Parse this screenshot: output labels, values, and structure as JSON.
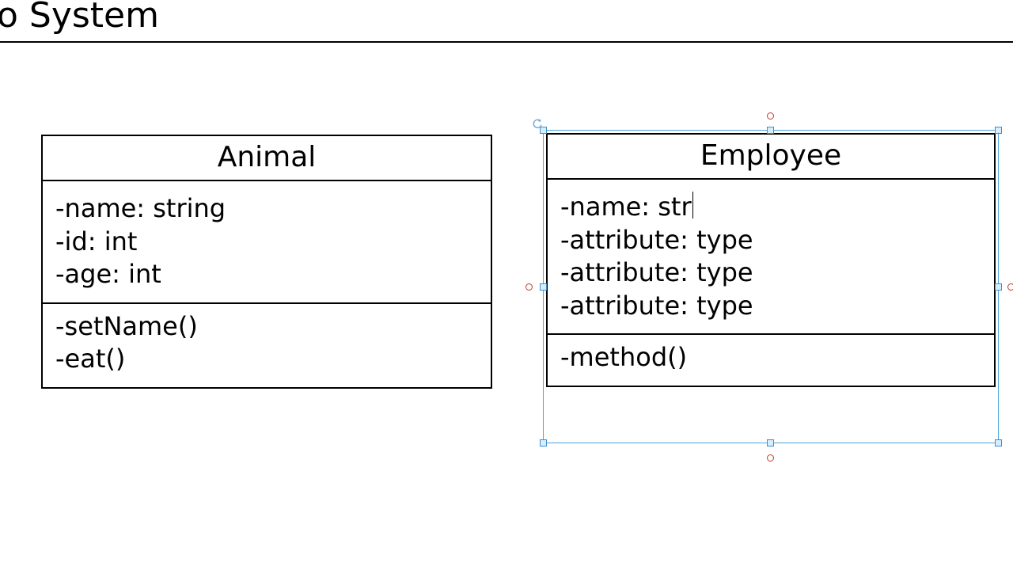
{
  "title": "o System",
  "classes": {
    "animal": {
      "name": "Animal",
      "attributes": [
        "-name: string",
        "-id: int",
        "-age: int"
      ],
      "methods": [
        "-setName()",
        "-eat()"
      ]
    },
    "employee": {
      "name": "Employee",
      "editing_attr_prefix": "-name: str",
      "attributes": [
        "-attribute: type",
        "-attribute: type",
        "-attribute: type"
      ],
      "methods": [
        "-method()"
      ]
    }
  },
  "chart_data": {
    "type": "table",
    "description": "UML class diagram with two classes",
    "classes": [
      {
        "name": "Animal",
        "attributes": [
          {
            "visibility": "-",
            "name": "name",
            "type": "string"
          },
          {
            "visibility": "-",
            "name": "id",
            "type": "int"
          },
          {
            "visibility": "-",
            "name": "age",
            "type": "int"
          }
        ],
        "methods": [
          {
            "visibility": "-",
            "name": "setName",
            "params": []
          },
          {
            "visibility": "-",
            "name": "eat",
            "params": []
          }
        ],
        "selected": false
      },
      {
        "name": "Employee",
        "attributes": [
          {
            "visibility": "-",
            "name": "name",
            "type": "str",
            "editing": true
          },
          {
            "visibility": "-",
            "name": "attribute",
            "type": "type"
          },
          {
            "visibility": "-",
            "name": "attribute",
            "type": "type"
          },
          {
            "visibility": "-",
            "name": "attribute",
            "type": "type"
          }
        ],
        "methods": [
          {
            "visibility": "-",
            "name": "method",
            "params": []
          }
        ],
        "selected": true
      }
    ],
    "relationships": []
  }
}
